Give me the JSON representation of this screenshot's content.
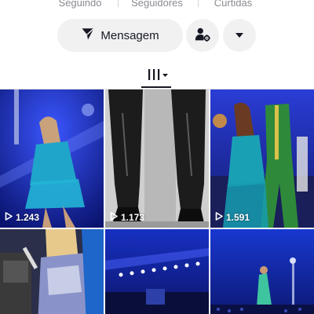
{
  "stats": {
    "following_label": "Seguindo",
    "followers_label": "Seguidores",
    "likes_label": "Curtidas"
  },
  "actions": {
    "message_label": "Mensagem",
    "message_icon": "send-icon",
    "friend_icon": "user-settings-icon",
    "more_icon": "caret-down-icon"
  },
  "tabs": {
    "active_icon": "grid-icon"
  },
  "videos": [
    {
      "views": "1.243",
      "scene": "singer on blue stage in sequined outfit"
    },
    {
      "views": "1.173",
      "scene": "black and white boots close-up"
    },
    {
      "views": "1.591",
      "scene": "dancers on stage"
    },
    {
      "views": "",
      "scene": "singer in silver top with microphone"
    },
    {
      "views": "",
      "scene": "concert crowd with stage lights"
    },
    {
      "views": "",
      "scene": "performer in teal dress on stage"
    }
  ],
  "colors": {
    "button_bg": "#f1f1f2",
    "text_primary": "#161823",
    "text_secondary": "#8a8b91",
    "stage_blue": "#1a2fb5"
  }
}
